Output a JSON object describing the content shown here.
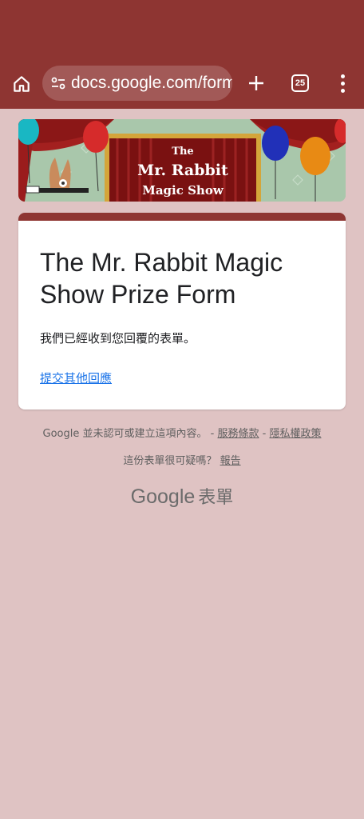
{
  "browser": {
    "url": "docs.google.com/forms/d/e/…",
    "tab_count": "25",
    "icons": {
      "home": "home-icon",
      "site_settings": "tune-icon",
      "new_tab": "plus-icon",
      "tabs": "tab-switcher-icon",
      "menu": "more-vert-icon"
    },
    "accent_color": "#8e3532"
  },
  "banner": {
    "line1": "The",
    "line2": "Mr. Rabbit",
    "line3": "Magic Show"
  },
  "form": {
    "title": "The Mr. Rabbit Magic Show Prize Form",
    "confirmation": "我們已經收到您回覆的表單。",
    "submit_another": "提交其他回應"
  },
  "footer": {
    "disclaimer": "Google 並未認可或建立這項內容。 -",
    "terms_link": "服務條款",
    "separator": "-",
    "privacy_link": "隱私權政策",
    "suspicious": "這份表單很可疑嗎？",
    "report_link": "報告",
    "logo_google": "Google",
    "logo_forms": "表單"
  }
}
